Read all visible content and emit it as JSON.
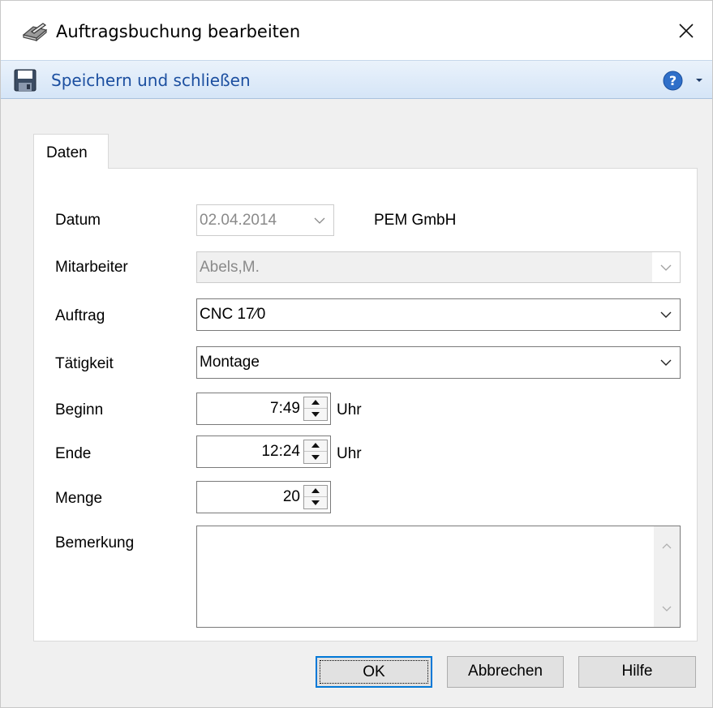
{
  "window": {
    "title": "Auftragsbuchung bearbeiten",
    "icon": "book-pen-icon",
    "close_icon": "close-icon"
  },
  "toolbar": {
    "save_close_label": "Speichern und schließen",
    "save_icon": "floppy-disk-icon",
    "help_icon": "help-icon"
  },
  "tabs": [
    {
      "label": "Daten",
      "active": true
    }
  ],
  "form": {
    "datum": {
      "label": "Datum",
      "value": "02.04.2014",
      "enabled": false
    },
    "company": "PEM GmbH",
    "mitarbeiter": {
      "label": "Mitarbeiter",
      "value": "Abels,M.",
      "enabled": false
    },
    "auftrag": {
      "label": "Auftrag",
      "value": "CNC 17⁄0"
    },
    "taetigkeit": {
      "label": "Tätigkeit",
      "value": "Montage"
    },
    "beginn": {
      "label": "Beginn",
      "value": "7:49",
      "unit": "Uhr"
    },
    "ende": {
      "label": "Ende",
      "value": "12:24",
      "unit": "Uhr"
    },
    "menge": {
      "label": "Menge",
      "value": "20"
    },
    "bemerkung": {
      "label": "Bemerkung",
      "value": ""
    }
  },
  "buttons": {
    "ok": "OK",
    "cancel": "Abbrechen",
    "help": "Hilfe"
  },
  "colors": {
    "toolbar_text": "#1c4fa0",
    "default_button_border": "#0078d7"
  }
}
